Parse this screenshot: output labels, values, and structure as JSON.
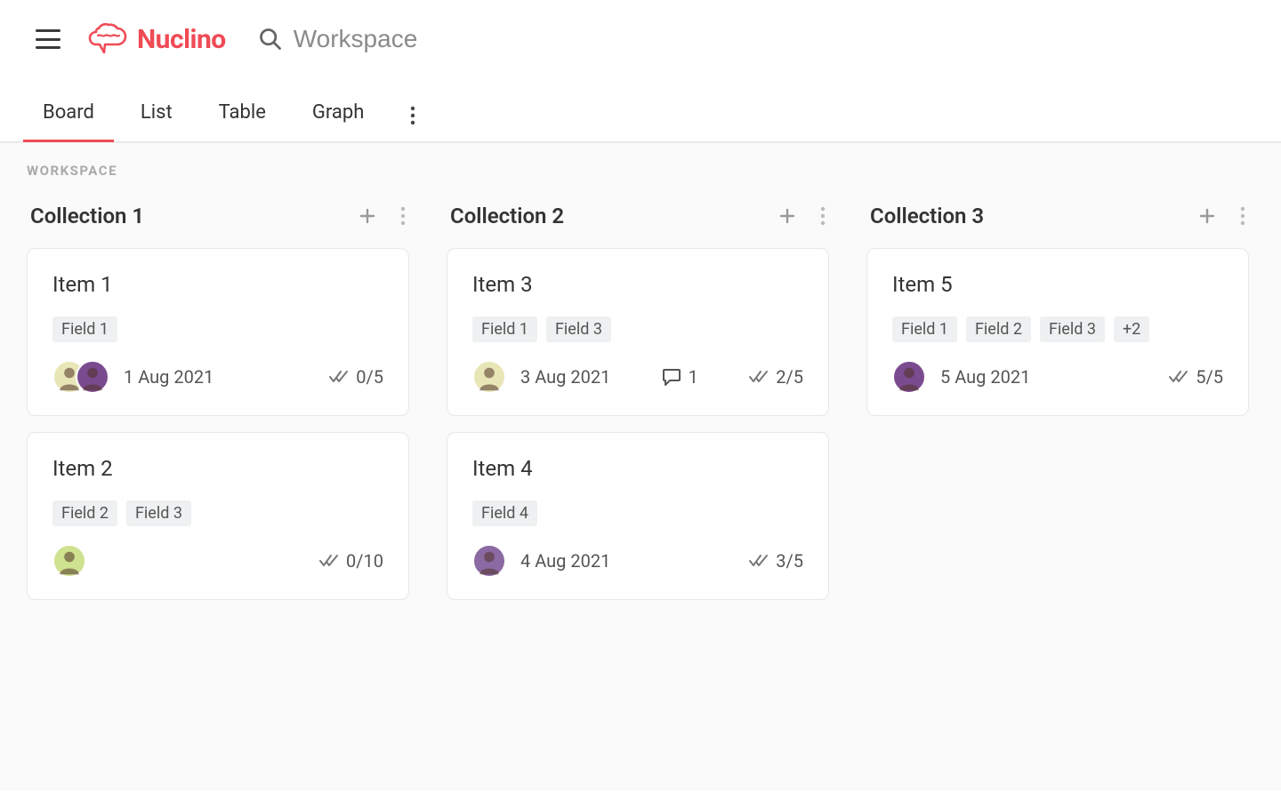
{
  "brand": {
    "name": "Nuclino"
  },
  "search": {
    "placeholder": "Workspace"
  },
  "tabs": {
    "items": [
      "Board",
      "List",
      "Table",
      "Graph"
    ],
    "active_index": 0
  },
  "breadcrumb": "WORKSPACE",
  "columns": [
    {
      "title": "Collection 1",
      "cards": [
        {
          "title": "Item 1",
          "tags": [
            "Field 1"
          ],
          "avatars": [
            "c1",
            "c2"
          ],
          "date": "1 Aug 2021",
          "comments": null,
          "checklist": "0/5"
        },
        {
          "title": "Item 2",
          "tags": [
            "Field 2",
            "Field 3"
          ],
          "avatars": [
            "c3"
          ],
          "date": "",
          "comments": null,
          "checklist": "0/10"
        }
      ]
    },
    {
      "title": "Collection 2",
      "cards": [
        {
          "title": "Item 3",
          "tags": [
            "Field 1",
            "Field 3"
          ],
          "avatars": [
            "c1"
          ],
          "date": "3 Aug 2021",
          "comments": "1",
          "checklist": "2/5"
        },
        {
          "title": "Item 4",
          "tags": [
            "Field 4"
          ],
          "avatars": [
            "c4"
          ],
          "date": "4 Aug 2021",
          "comments": null,
          "checklist": "3/5"
        }
      ]
    },
    {
      "title": "Collection 3",
      "cards": [
        {
          "title": "Item 5",
          "tags": [
            "Field 1",
            "Field 2",
            "Field 3",
            "+2"
          ],
          "avatars": [
            "c2"
          ],
          "date": "5 Aug 2021",
          "comments": null,
          "checklist": "5/5"
        }
      ]
    }
  ]
}
